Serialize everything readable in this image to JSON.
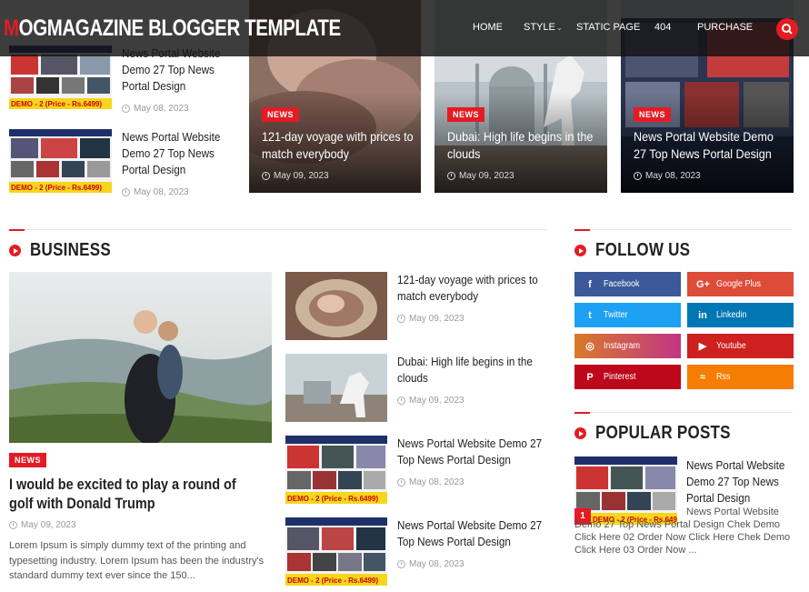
{
  "header": {
    "logo_first": "M",
    "logo_rest": "OGMAGAZINE BLOGGER TEMPLATE",
    "nav": [
      "HOME",
      "STYLE",
      "STATIC PAGE",
      "404",
      "PURCHASE"
    ]
  },
  "top_list": [
    {
      "title": "News Portal Website Demo 27 Top News Portal Design",
      "date": "May 08, 2023"
    },
    {
      "title": "News Portal Website Demo 27 Top News Portal Design",
      "date": "May 08, 2023"
    }
  ],
  "slider": [
    {
      "badge": "NEWS",
      "title": "121-day voyage with prices to match everybody",
      "date": "May 09, 2023"
    },
    {
      "badge": "NEWS",
      "title": "Dubai: High life begins in the clouds",
      "date": "May 09, 2023"
    },
    {
      "badge": "NEWS",
      "title": "News Portal Website Demo 27 Top News Portal Design",
      "date": "May 08, 2023"
    }
  ],
  "business": {
    "heading": "BUSINESS",
    "featured": {
      "badge": "NEWS",
      "title": "I would be excited to play a round of golf with Donald Trump",
      "date": "May 09, 2023",
      "excerpt": "Lorem Ipsum is simply dummy text of the printing and typesetting industry. Lorem Ipsum has been the industry's standard dummy text ever since the 150..."
    },
    "list": [
      {
        "title": "121-day voyage with prices to match everybody",
        "date": "May 09, 2023"
      },
      {
        "title": "Dubai: High life begins in the clouds",
        "date": "May 09, 2023"
      },
      {
        "title": "News Portal Website Demo 27 Top News Portal Design",
        "date": "May 08, 2023"
      },
      {
        "title": "News Portal Website Demo 27 Top News Portal Design",
        "date": "May 08, 2023"
      }
    ]
  },
  "follow": {
    "heading": "FOLLOW US",
    "links": [
      {
        "label": "Facebook",
        "icon": "f",
        "color": "#3b5998"
      },
      {
        "label": "Google Plus",
        "icon": "G+",
        "color": "#dd4b39"
      },
      {
        "label": "Twitter",
        "icon": "t",
        "color": "#1da1f2"
      },
      {
        "label": "Linkedin",
        "icon": "in",
        "color": "#0077b5"
      },
      {
        "label": "Instagram",
        "icon": "◎",
        "color": "#c13584"
      },
      {
        "label": "Youtube",
        "icon": "▶",
        "color": "#cd201f"
      },
      {
        "label": "Pinterest",
        "icon": "P",
        "color": "#bd081c"
      },
      {
        "label": "Rss",
        "icon": "≈",
        "color": "#f57d00"
      }
    ]
  },
  "popular": {
    "heading": "POPULAR POSTS",
    "rank": "1",
    "title": "News Portal Website Demo 27 Top News Portal Design",
    "text": "News Portal Website Demo 27 Top News Portal Design Chek Demo  Click Here 02 Order Now  Click Here Chek Demo  Click Here 03 Order Now  ..."
  },
  "thumb_text": {
    "demo": "DEMO - 2  (Price - Rs.6499)"
  }
}
